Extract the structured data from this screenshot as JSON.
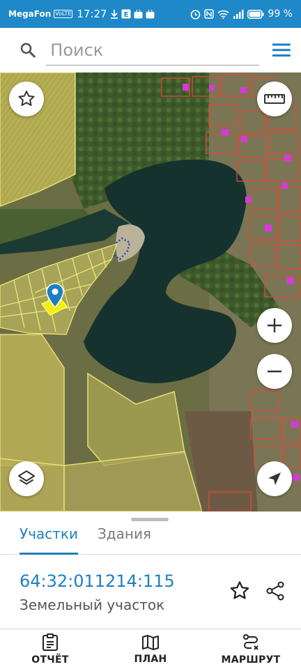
{
  "status_bar": {
    "carrier": "MegaFon",
    "network_badge": "VoLTE",
    "time": "17:27",
    "notification_icons": [
      "download-icon",
      "e-app-icon",
      "bag-icon",
      "bag-icon"
    ],
    "battery": "99 %"
  },
  "search": {
    "placeholder": "Поиск",
    "value": ""
  },
  "map": {
    "buttons": [
      "favorites-star",
      "ruler",
      "zoom-in",
      "zoom-out",
      "layers",
      "my-location"
    ],
    "colors": {
      "parcel_fill": "#d8cf6a",
      "parcel_stroke": "#e6e07a",
      "selected_parcel": "#f2ee10",
      "building_outline": "#e0493a",
      "building_fill": "#d43bd6",
      "water": "#16322e",
      "marker": "#1e7fc0"
    }
  },
  "sheet": {
    "tabs": [
      {
        "label": "Участки",
        "active": true
      },
      {
        "label": "Здания",
        "active": false
      }
    ],
    "parcel_number": "64:32:011214:115",
    "parcel_type": "Земельный участок"
  },
  "nav": [
    {
      "label": "ОТЧЁТ",
      "icon": "report-icon"
    },
    {
      "label": "ПЛАН",
      "icon": "map-icon"
    },
    {
      "label": "МАРШРУТ",
      "icon": "route-icon"
    }
  ],
  "accent_color": "#1e7fc0"
}
